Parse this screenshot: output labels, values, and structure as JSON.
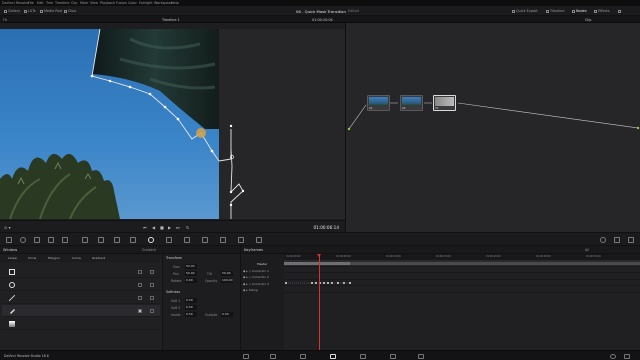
{
  "menubar": {
    "items": [
      "DaVinci Resolve",
      "File",
      "Edit",
      "Trim",
      "Timeline",
      "Clip",
      "Mark",
      "View",
      "Playback",
      "Fusion",
      "Color",
      "Fairlight",
      "Workspace",
      "Help"
    ]
  },
  "toolbar": {
    "left_items": [
      "Gallery",
      "LUTs",
      "Media Pool",
      "Clips"
    ],
    "project_title": "06 - Quick Mask Transition",
    "project_status": "Edited",
    "right_items": [
      "Quick Export",
      "Timeline",
      "Nodes",
      "Effects"
    ],
    "lightbox": ""
  },
  "subbar": {
    "fit_label": "Fit",
    "timeline_label": "Timeline 1",
    "timecode_top": "01:00:10:04",
    "clip_label": "Clip"
  },
  "viewer": {
    "timecode": "01:00:06:14"
  },
  "nodes": {
    "items": [
      {
        "label": "01"
      },
      {
        "label": "02"
      },
      {
        "label": "03"
      }
    ]
  },
  "window_panel": {
    "title": "Window",
    "column_header": "Gradient",
    "tools": [
      "Linear",
      "Circle",
      "Polygon",
      "Curve",
      "Gradient"
    ],
    "rows": [
      "square",
      "circle",
      "line",
      "pen",
      "gradient"
    ],
    "transform": {
      "title": "Transform",
      "fields": [
        {
          "label": "Size",
          "value": "50.00"
        },
        {
          "label": "Pan",
          "value": "50.00"
        },
        {
          "label": "Rotate",
          "value": "0.00"
        },
        {
          "label": "Tilt",
          "value": "50.00"
        },
        {
          "label": "Opacity",
          "value": "100.00"
        }
      ],
      "softness_title": "Softness",
      "softness": [
        {
          "label": "Soft 1",
          "value": "0.50"
        },
        {
          "label": "Soft 2",
          "value": "0.50"
        },
        {
          "label": "Inside",
          "value": "0.50"
        },
        {
          "label": "Outside",
          "value": "0.50"
        }
      ]
    }
  },
  "keyframes": {
    "title": "Keyframes",
    "filter": "All",
    "ruler": [
      "01:00:00:00",
      "01:00:05:00",
      "01:00:10:00",
      "01:00:15:00",
      "01:00:20:00",
      "01:00:25:00",
      "01:00:30:00",
      "01:00:35:00"
    ],
    "tracks": [
      "Master",
      "Corrector 1",
      "Corrector 2",
      "Corrector 3",
      "Sizing"
    ]
  },
  "statusbar": {
    "app_name": "DaVinci Resolve Studio 18.6"
  },
  "colors": {
    "accent_red": "#e23a2e",
    "playhead": "#d9342b",
    "sky": "#2f78b8",
    "panel_bg": "#202023"
  }
}
